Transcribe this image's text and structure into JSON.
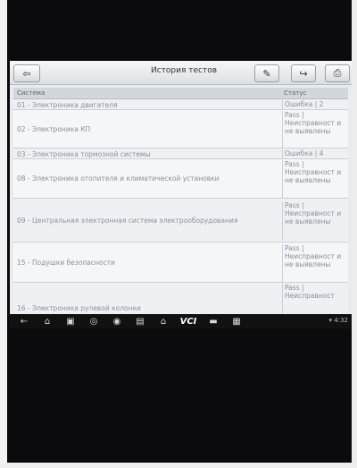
{
  "header": {
    "title": "История тестов"
  },
  "table": {
    "columns": [
      "Система",
      "Статус"
    ],
    "rows": [
      {
        "system": "01 - Электроника двигателя",
        "status": "Ошибка | 2"
      },
      {
        "system": "02 - Электроника КП",
        "status": "Pass | Неисправност и не выявлены"
      },
      {
        "system": "03 - Электроника тормозной системы",
        "status": "Ошибка | 4"
      },
      {
        "system": "08 - Электроника отопителя и климатической установки",
        "status": "Pass | Неисправност и не выявлены"
      },
      {
        "system": "09 - Центральная электронная система электрооборудования",
        "status": "Pass | Неисправност и не выявлены"
      },
      {
        "system": "15 - Подушки безопасности",
        "status": "Pass | Неисправност и не выявлены"
      },
      {
        "system": "16 - Электроника рулевой колонки",
        "status": "Pass | Неисправност"
      }
    ]
  },
  "navbar": {
    "vci_label": "VCI",
    "status_text": "4:32"
  },
  "colors": {
    "titlebar": "#e3e6ea",
    "table_header": "#d2d7dd",
    "navbar": "#111111"
  }
}
